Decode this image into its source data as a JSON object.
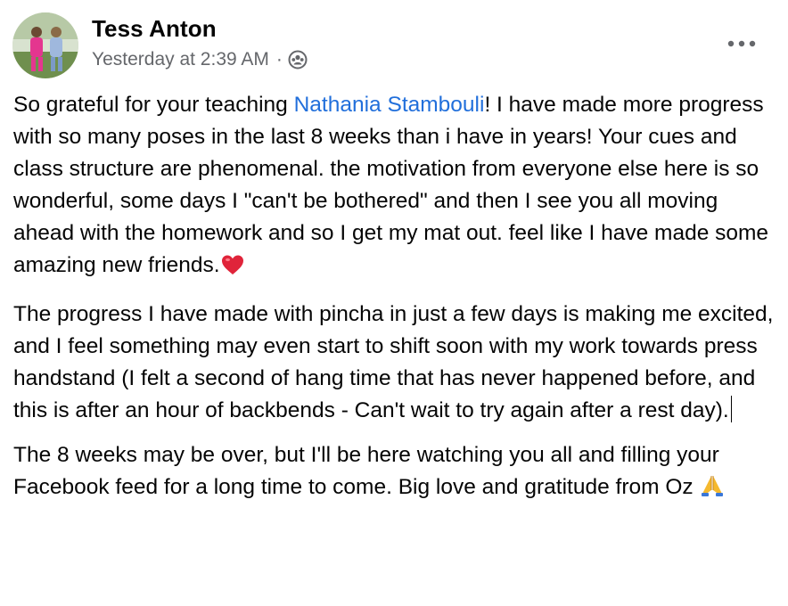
{
  "post": {
    "author": "Tess Anton",
    "timestamp": "Yesterday at 2:39 AM",
    "separator": "·",
    "audience_icon": "friends-audience-icon",
    "more_icon": "more-options-icon",
    "paragraphs": [
      {
        "before_mention": "So grateful for your teaching ",
        "mention": "Nathania Stambouli",
        "after_mention": "! I have made more progress with so many poses in the last 8 weeks than i have in years! Your cues and class structure are phenomenal. the motivation from everyone else here is so wonderful, some days I \"can't be bothered\" and then I see you all moving ahead with the homework and so I get my mat out. feel like I have made some amazing new friends.",
        "trailing_emoji": "heart-emoji"
      },
      {
        "text": "The progress I have made with pincha in just a few days is making me excited, and I feel something may even start to shift soon with my work towards press handstand (I felt a second of hang time that has never happened before, and this is after an hour of backbends - Can't wait to try again after a rest day)."
      },
      {
        "text": "The 8 weeks may be over, but I'll be here watching you all and filling your Facebook feed for a long time to come. Big love and gratitude from Oz ",
        "trailing_emoji": "praying-hands-emoji"
      }
    ],
    "colors": {
      "mention": "#216fdb",
      "meta": "#65676b",
      "text": "#050505",
      "heart": "#e0243a",
      "praying_hands": "#f5b92e"
    }
  }
}
